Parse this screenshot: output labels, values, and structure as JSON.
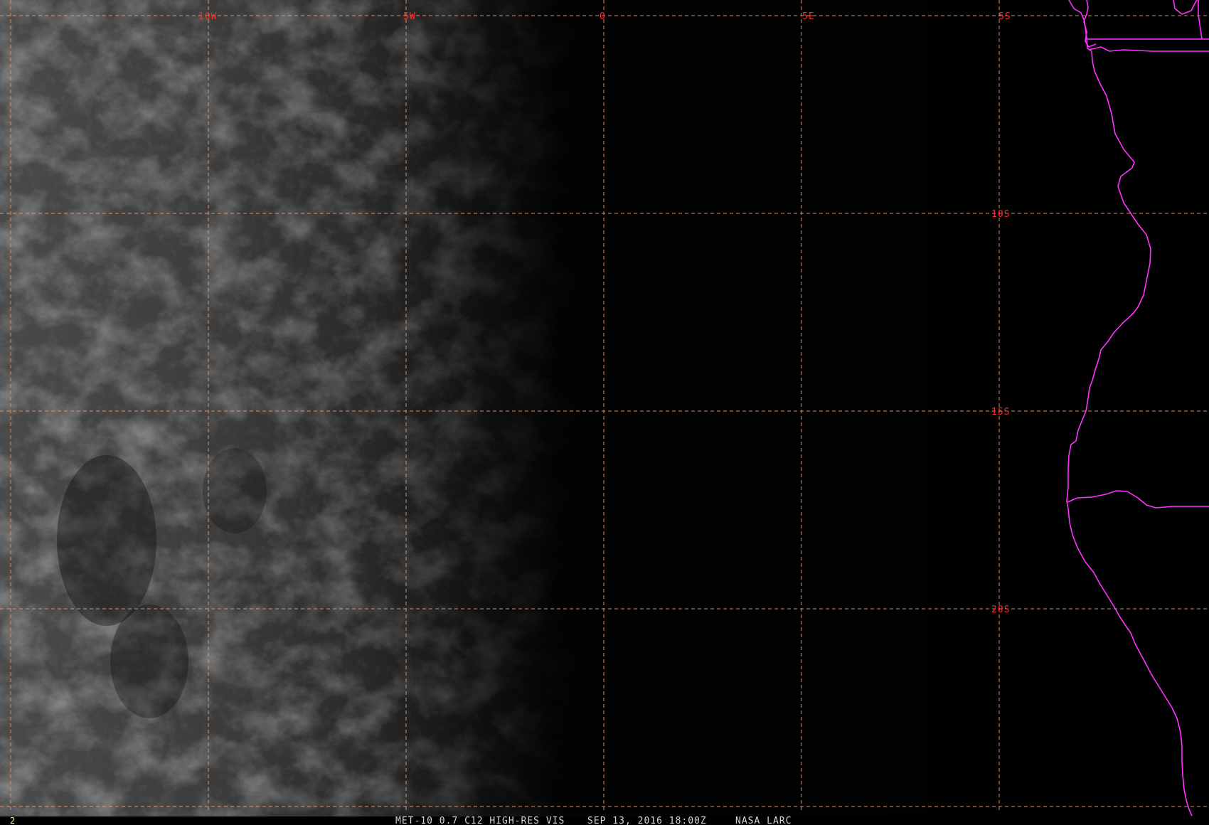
{
  "colors": {
    "background": "#000000",
    "grid": "#e8a070",
    "grid_labels": "#ff2a2a",
    "coastline": "#ff33ff",
    "caption": "#d8d8d8",
    "frame_number": "#ffff66"
  },
  "map": {
    "projection": "lat-lon",
    "longitude_labels": [
      "10W",
      "5W",
      "0",
      "5E",
      "5S"
    ],
    "latitude_labels": [
      "10S",
      "15S",
      "20S"
    ],
    "imagery": "visible-channel cloud field, bright stratocumulus on west side fading to dark toward east (night terminator)"
  },
  "footer": {
    "frame_number": "2",
    "product": "MET-10 0.7 C12 HIGH-RES VIS",
    "datetime": "SEP 13, 2016 18:00Z",
    "source": "NASA LARC"
  }
}
